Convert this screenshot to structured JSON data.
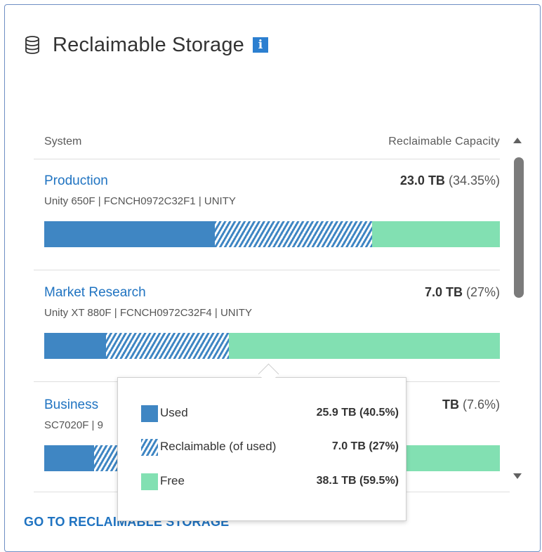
{
  "widget": {
    "title": "Reclaimable Storage",
    "info_icon": "i",
    "icons": {
      "header": "database-icon",
      "info": "info-icon"
    }
  },
  "table": {
    "headers": {
      "system": "System",
      "capacity": "Reclaimable Capacity"
    },
    "rows": [
      {
        "name": "Production",
        "meta": "Unity 650F | FCNCH0972C32F1 | UNITY",
        "capacity_value": "23.0 TB",
        "capacity_pct": "(34.35%)",
        "bar": {
          "used": 0.375,
          "reclaimable": 0.345,
          "free": 0.28
        }
      },
      {
        "name": "Market Research",
        "meta": "Unity XT 880F | FCNCH0972C32F4 | UNITY",
        "capacity_value": "7.0 TB",
        "capacity_pct": "(27%)",
        "bar": {
          "used": 0.135,
          "reclaimable": 0.27,
          "free": 0.595
        }
      },
      {
        "name": "Business",
        "meta": "SC7020F | 9",
        "capacity_value": "TB",
        "capacity_pct": "(7.6%)",
        "bar": {
          "used": 0.11,
          "reclaimable": 0.05,
          "free": 0.84
        }
      }
    ]
  },
  "tooltip": {
    "items": [
      {
        "label": "Used",
        "value": "25.9 TB (40.5%)"
      },
      {
        "label": "Reclaimable (of used)",
        "value": "7.0 TB (27%)"
      },
      {
        "label": "Free",
        "value": "38.1 TB (59.5%)"
      }
    ]
  },
  "footer": {
    "link": "GO TO RECLAIMABLE STORAGE"
  },
  "colors": {
    "used": "#3f86c3",
    "free": "#82e0b2",
    "link": "#1f73c1",
    "info": "#2c7fd0"
  }
}
